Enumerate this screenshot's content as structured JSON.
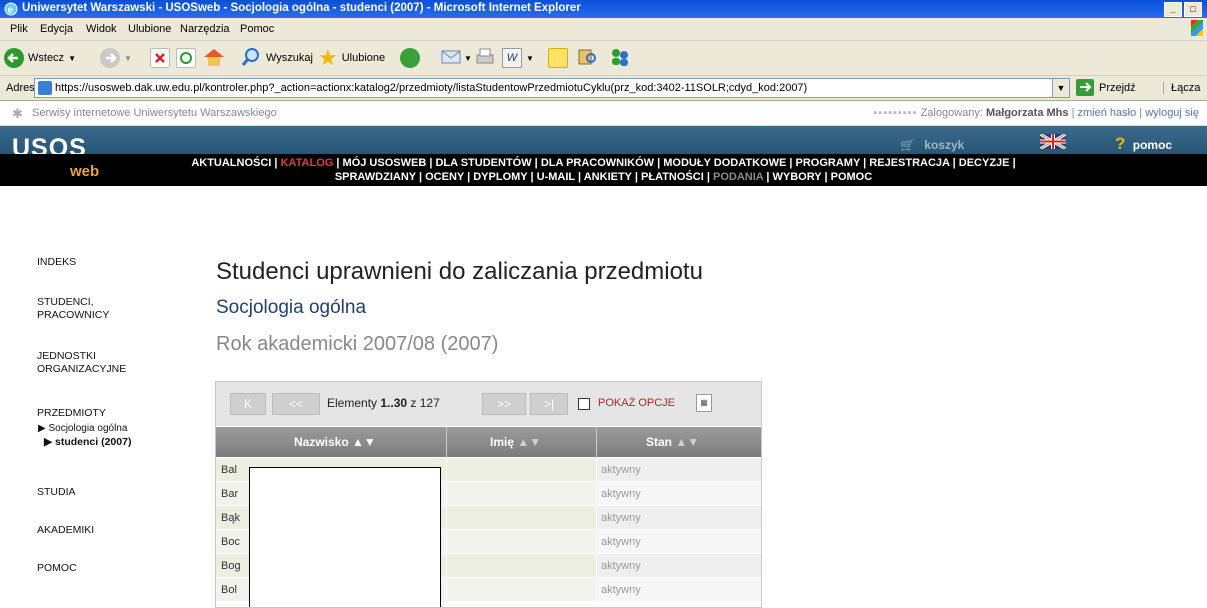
{
  "window": {
    "title": "Uniwersytet Warszawski - USOSweb - Socjologia ogólna - studenci (2007) - Microsoft Internet Explorer",
    "min_label": "_",
    "max_label": "□"
  },
  "menu": [
    "Plik",
    "Edycja",
    "Widok",
    "Ulubione",
    "Narzędzia",
    "Pomoc"
  ],
  "toolbar": {
    "back_label": "Wstecz",
    "search_label": "Wyszukaj",
    "favorites_label": "Ulubione"
  },
  "address": {
    "label": "Adres",
    "url": "https://usosweb.dak.uw.edu.pl/kontroler.php?_action=actionx:katalog2/przedmioty/listaStudentowPrzedmiotuCyklu(prz_kod:3402-11SOLR;cdyd_kod:2007)",
    "go_label": "Przejdź",
    "links_label": "Łącza"
  },
  "site_top": {
    "left_text": "Serwisy internetowe Uniwersytetu Warszawskiego",
    "dots": "▪▪▪▪▪▪▪▪▪",
    "logged_label": "Zalogowany:",
    "user": "Małgorzata Mhs",
    "change_password": "zmień hasło",
    "logout": "wyloguj się"
  },
  "header": {
    "logo_main": "USOS",
    "logo_sub": "web",
    "cart_label": "koszyk",
    "help_label": "pomoc",
    "help_mark": "?",
    "nav_line1": [
      {
        "label": "AKTUALNOŚCI",
        "state": "normal"
      },
      {
        "label": "KATALOG",
        "state": "active"
      },
      {
        "label": "MÓJ USOSWEB",
        "state": "normal"
      },
      {
        "label": "DLA STUDENTÓW",
        "state": "normal"
      },
      {
        "label": "DLA PRACOWNIKÓW",
        "state": "normal"
      },
      {
        "label": "MODUŁY DODATKOWE",
        "state": "normal"
      },
      {
        "label": "PROGRAMY",
        "state": "normal"
      },
      {
        "label": "REJESTRACJA",
        "state": "normal"
      },
      {
        "label": "DECYZJE",
        "state": "normal"
      }
    ],
    "nav_line2": [
      {
        "label": "SPRAWDZIANY",
        "state": "normal"
      },
      {
        "label": "OCENY",
        "state": "normal"
      },
      {
        "label": "DYPLOMY",
        "state": "normal"
      },
      {
        "label": "U-MAIL",
        "state": "normal"
      },
      {
        "label": "ANKIETY",
        "state": "normal"
      },
      {
        "label": "PŁATNOŚCI",
        "state": "normal"
      },
      {
        "label": "PODANIA",
        "state": "dim"
      },
      {
        "label": "WYBORY",
        "state": "normal"
      },
      {
        "label": "POMOC",
        "state": "normal"
      }
    ],
    "active_color": "#e43b37"
  },
  "sidebar": {
    "indeks": "INDEKS",
    "studenci_1": "STUDENCI,",
    "studenci_2": "PRACOWNICY",
    "jednostki_1": "JEDNOSTKI",
    "jednostki_2": "ORGANIZACYJNE",
    "przedmioty": "PRZEDMIOTY",
    "sub1": "▶ Socjologia ogólna",
    "sub2": "▶ studenci (2007)",
    "studia": "STUDIA",
    "akademiki": "AKADEMIKI",
    "pomoc": "POMOC"
  },
  "main": {
    "title": "Studenci uprawnieni do zaliczania przedmiotu",
    "subject": "Socjologia ogólna",
    "year": "Rok akademicki 2007/08 (2007)"
  },
  "pager": {
    "first": "K",
    "prev": "<<",
    "next": ">>",
    "last": ">|",
    "elements_prefix": "Elementy ",
    "elements_range": "1..30",
    "elements_suffix": " z 127",
    "show_options": "POKAŻ OPCJE"
  },
  "table": {
    "col_surname": "Nazwisko",
    "col_name": "Imię",
    "col_status": "Stan",
    "sort_arrows": "▲▼",
    "rows": [
      {
        "surname": "Bal",
        "name": "",
        "status": "aktywny"
      },
      {
        "surname": "Bar",
        "name": "",
        "status": "aktywny"
      },
      {
        "surname": "Bąk",
        "name": "",
        "status": "aktywny"
      },
      {
        "surname": "Boc",
        "name": "",
        "status": "aktywny"
      },
      {
        "surname": "Bog",
        "name": "",
        "status": "aktywny"
      },
      {
        "surname": "Bol",
        "name": "",
        "status": "aktywny"
      }
    ]
  }
}
